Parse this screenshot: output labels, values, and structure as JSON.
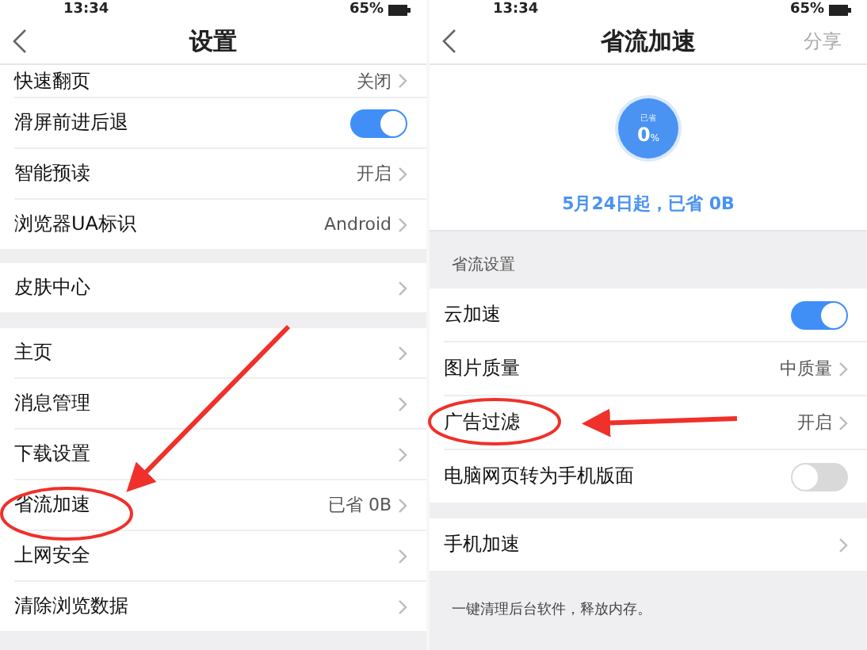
{
  "left_screen": {
    "status_bar": {
      "time": "13:34",
      "battery": "65%"
    },
    "title": "设置",
    "sections": [
      {
        "rows": [
          {
            "kind": "value",
            "label": "快速翻页",
            "value": "关闭"
          },
          {
            "kind": "toggle",
            "label": "滑屏前进后退",
            "on": true
          },
          {
            "kind": "value",
            "label": "智能预读",
            "value": "开启"
          },
          {
            "kind": "value",
            "label": "浏览器UA标识",
            "value": "Android"
          }
        ]
      },
      {
        "rows": [
          {
            "kind": "link",
            "label": "皮肤中心"
          }
        ]
      },
      {
        "rows": [
          {
            "kind": "link",
            "label": "主页"
          },
          {
            "kind": "link",
            "label": "消息管理"
          },
          {
            "kind": "link",
            "label": "下载设置"
          },
          {
            "kind": "value",
            "label": "省流加速",
            "value": "已省 0B"
          },
          {
            "kind": "link",
            "label": "上网安全"
          },
          {
            "kind": "link",
            "label": "清除浏览数据"
          }
        ]
      }
    ]
  },
  "right_screen": {
    "status_bar": {
      "time": "13:34",
      "battery": "65%"
    },
    "title": "省流加速",
    "action": "分享",
    "gauge": {
      "caption": "已省",
      "number": "0",
      "unit": "%"
    },
    "summary": "5月24日起，已省 0B",
    "section_title": "省流设置",
    "sections": [
      {
        "rows": [
          {
            "kind": "toggle",
            "label": "云加速",
            "on": true
          },
          {
            "kind": "value",
            "label": "图片质量",
            "value": "中质量"
          },
          {
            "kind": "value",
            "label": "广告过滤",
            "value": "开启"
          },
          {
            "kind": "toggle",
            "label": "电脑网页转为手机版面",
            "on": false
          }
        ]
      },
      {
        "rows": [
          {
            "kind": "link",
            "label": "手机加速"
          }
        ]
      }
    ],
    "footnote": "一键清理后台软件，释放内存。"
  }
}
